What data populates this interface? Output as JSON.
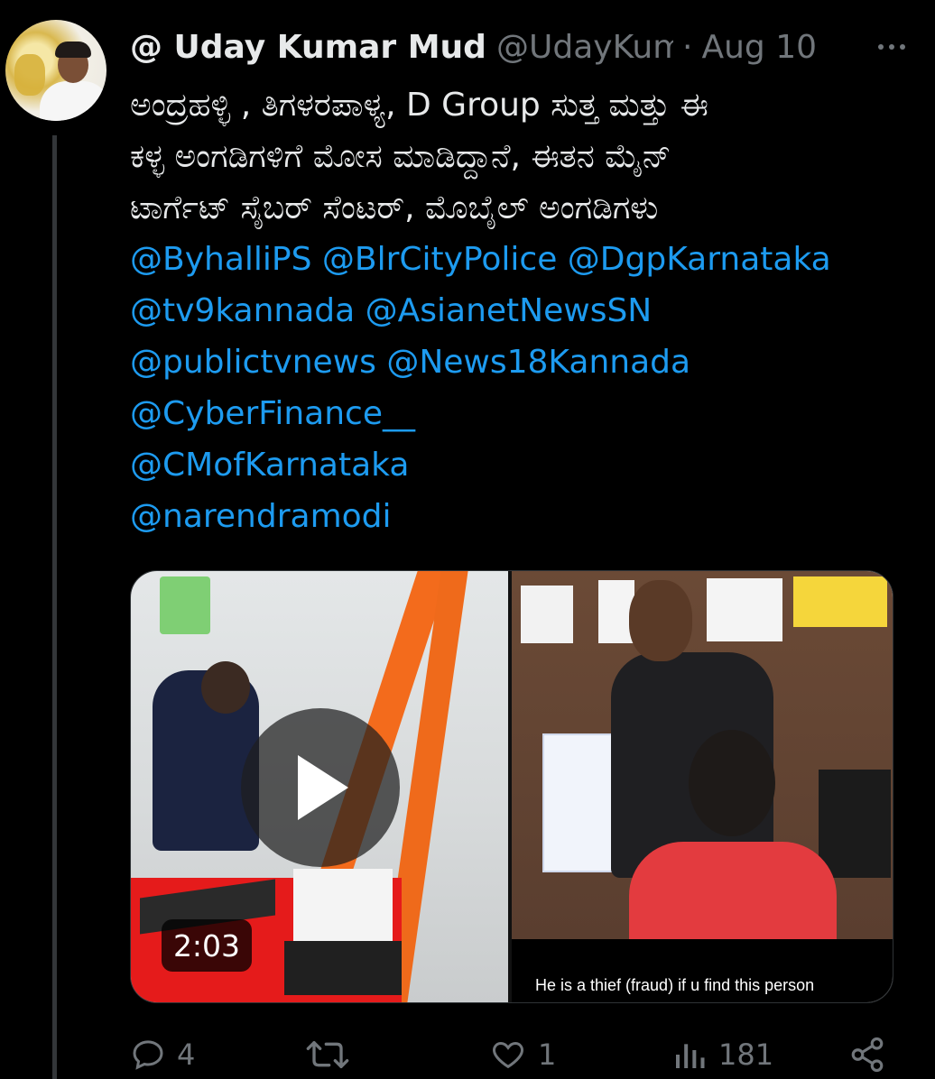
{
  "tweet": {
    "display_name": "@ Uday Kumar Mudaliar",
    "handle": "@UdayKumar",
    "separator": "·",
    "date": "Aug 10",
    "text_lines": [
      "ಅಂದ್ರಹಳ್ಳಿ , ತಿಗಳರಪಾಳ್ಯ, D Group ಸುತ್ತ ಮತ್ತು ಈ",
      "ಕಳ್ಳ  ಅಂಗಡಿಗಳಿಗೆ ಮೋಸ ಮಾಡಿದ್ದಾನೆ, ಈತನ ಮೈನ್",
      "ಟಾರ್ಗೆಟ್ ಸೈಬರ್ ಸೆಂಟರ್, ಮೊಬೈಲ್ ಅಂಗಡಿಗಳು"
    ],
    "mention_lines": [
      "@ByhalliPS @BlrCityPolice @DgpKarnataka",
      "@tv9kannada @AsianetNewsSN",
      "@publictvnews @News18Kannada",
      "@CyberFinance__",
      "@CMofKarnataka",
      "@narendramodi"
    ],
    "media": {
      "duration": "2:03",
      "caption": "He is a thief (fraud)  if u find this person"
    },
    "actions": {
      "replies": "4",
      "reposts": "",
      "likes": "1",
      "views": "181"
    }
  },
  "colors": {
    "background": "#000000",
    "text": "#e7e9ea",
    "secondary": "#71767b",
    "link": "#1d9bf0",
    "thread_line": "#333639"
  },
  "icons": [
    "more-icon",
    "play-icon",
    "reply-icon",
    "repost-icon",
    "like-icon",
    "views-icon",
    "share-icon"
  ]
}
